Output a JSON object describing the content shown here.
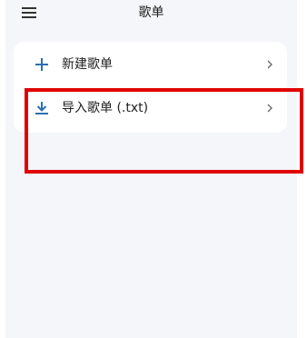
{
  "header": {
    "title": "歌单",
    "menu_icon": "hamburger-menu-icon"
  },
  "playlist_actions": [
    {
      "label": "新建歌单",
      "icon": "plus-icon",
      "trailing_icon": "chevron-right-icon"
    },
    {
      "label": "导入歌单 (.txt)",
      "icon": "download-icon",
      "trailing_icon": "chevron-right-icon"
    }
  ],
  "colors": {
    "accent": "#2a6fb3",
    "background": "#f5f6f9",
    "card": "#ffffff",
    "highlight_box": "#e00000"
  }
}
